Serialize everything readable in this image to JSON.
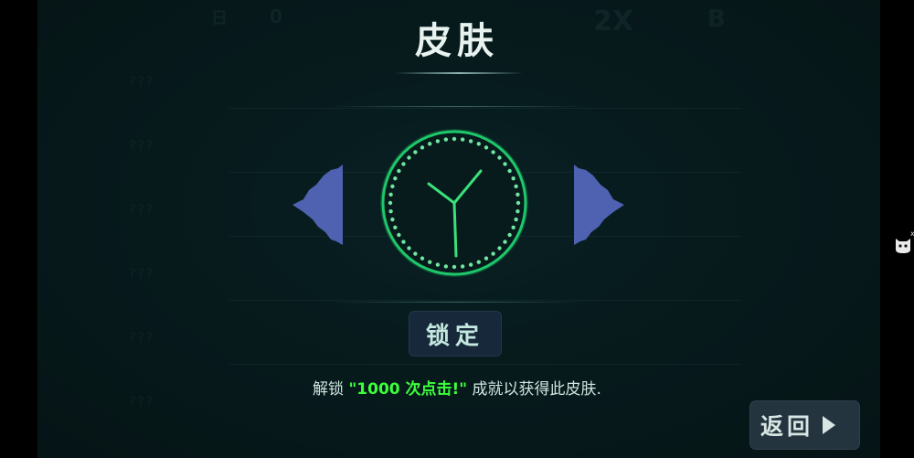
{
  "screen": {
    "title": "皮肤",
    "lock_label": "锁定",
    "hint": {
      "prefix": "解锁 ",
      "achievement": "\"1000 次点击!\"",
      "suffix": " 成就以获得此皮肤."
    },
    "back_label": "返回"
  },
  "background": {
    "top_bar": [
      "日",
      "0",
      "2X",
      "",
      "B",
      ""
    ],
    "list_marks": [
      "???",
      "???",
      "???",
      "???",
      "???",
      "???",
      "???"
    ]
  },
  "colors": {
    "accent_green": "#3cff3c",
    "clock_ring": "#1ec86a",
    "arrow_blue": "#4f62b2",
    "lock_bg": "#16283a",
    "back_bg": "#24343f"
  },
  "icons": {
    "prev": "triangle-left-icon",
    "next": "triangle-right-icon",
    "skin_preview": "clock-icon",
    "back": "play-arrow-icon",
    "side": "cat-face-icon",
    "side_close": "close-icon"
  }
}
